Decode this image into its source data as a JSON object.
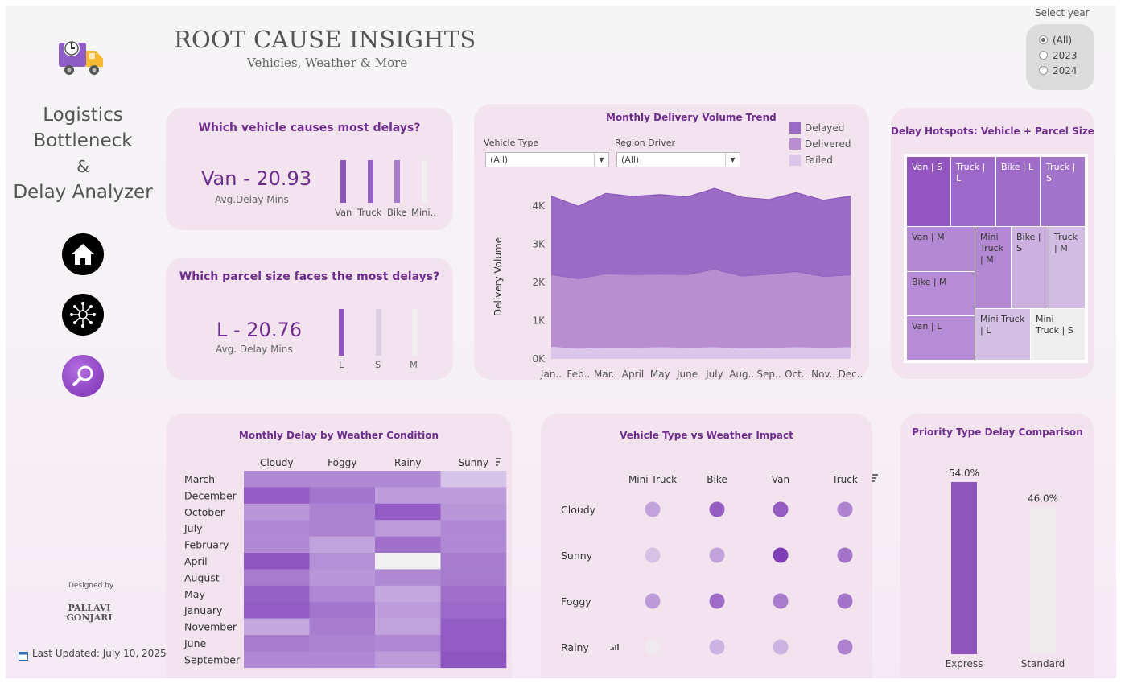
{
  "header": {
    "title": "ROOT CAUSE INSIGHTS",
    "subtitle": "Vehicles, Weather & More"
  },
  "sidebar": {
    "app_title_lines": [
      "Logistics",
      "Bottleneck",
      "&",
      "Delay Analyzer"
    ],
    "nav": [
      {
        "icon": "home-icon"
      },
      {
        "icon": "network-icon"
      },
      {
        "icon": "magnifier-icon"
      }
    ],
    "designed_by_label": "Designed by",
    "designer_name_lines": [
      "PALLAVI",
      "GONJARI"
    ],
    "last_updated": "Last Updated: July 10, 2025"
  },
  "year_filter": {
    "label": "Select year",
    "options": [
      "(All)",
      "2023",
      "2024"
    ],
    "selected": "(All)"
  },
  "vehicle_kpi": {
    "question": "Which vehicle causes most delays?",
    "value": "Van - 20.93",
    "caption": "Avg.Delay Mins",
    "bars": [
      {
        "label": "Van",
        "level": 1.0
      },
      {
        "label": "Truck",
        "level": 1.0
      },
      {
        "label": "Bike",
        "level": 1.0
      },
      {
        "label": "Mini..",
        "level": 1.0
      }
    ]
  },
  "parcel_kpi": {
    "question": "Which parcel size faces the most delays?",
    "value": "L - 20.76",
    "caption": "Avg. Delay Mins",
    "bars": [
      {
        "label": "L"
      },
      {
        "label": "S"
      },
      {
        "label": "M"
      }
    ]
  },
  "colors": {
    "accent": "#8e55bd",
    "title": "#6f2e8e",
    "delayed": "#9b6cc6",
    "delivered": "#b98ed0",
    "failed": "#dcc6ea"
  },
  "trend": {
    "title": "Monthly Delivery Volume Trend",
    "filters": [
      {
        "label": "Vehicle Type",
        "value": "(All)"
      },
      {
        "label": "Region Driver",
        "value": "(All)"
      }
    ],
    "legend": [
      "Delayed",
      "Delivered",
      "Failed"
    ],
    "chart_data": {
      "type": "area",
      "stacked": true,
      "categories": [
        "Jan..",
        "Feb..",
        "Mar..",
        "April",
        "May",
        "June",
        "July",
        "Aug..",
        "Sep..",
        "Oct..",
        "Nov..",
        "Dec.."
      ],
      "ylabel": "Delivery Volume",
      "yticks": [
        "4K",
        "3K",
        "2K",
        "1K",
        "0K"
      ],
      "ylim": [
        0,
        4400
      ],
      "series": [
        {
          "name": "Failed",
          "values": [
            330,
            280,
            300,
            300,
            320,
            300,
            320,
            290,
            300,
            320,
            300,
            320
          ]
        },
        {
          "name": "Delivered",
          "values": [
            1880,
            1820,
            1930,
            1910,
            1900,
            1910,
            2030,
            1880,
            1920,
            1970,
            1860,
            1880
          ]
        },
        {
          "name": "Delayed",
          "values": [
            2050,
            1890,
            2100,
            2040,
            2080,
            2030,
            2110,
            2060,
            1950,
            2060,
            1990,
            2060
          ]
        }
      ]
    }
  },
  "treemap": {
    "title": "Delay Hotspots: Vehicle + Parcel Size",
    "cells": [
      "Van | S",
      "Truck | L",
      "Bike | L",
      "Truck | S",
      "Van | M",
      "Mini Truck | M",
      "Bike | S",
      "Truck | M",
      "Bike | M",
      "Van | L",
      "Mini Truck | L",
      "Mini Truck | S"
    ]
  },
  "weather_heatmap": {
    "title": "Monthly Delay by Weather Condition",
    "columns": [
      "Cloudy",
      "Foggy",
      "Rainy",
      "Sunny"
    ],
    "rows": [
      "March",
      "December",
      "October",
      "July",
      "February",
      "April",
      "August",
      "May",
      "January",
      "November",
      "June",
      "September"
    ],
    "chart_data": {
      "type": "heatmap",
      "x": [
        "Cloudy",
        "Foggy",
        "Rainy",
        "Sunny"
      ],
      "y": [
        "March",
        "December",
        "October",
        "July",
        "February",
        "April",
        "August",
        "May",
        "January",
        "November",
        "June",
        "September"
      ],
      "values": [
        [
          0.55,
          0.55,
          0.55,
          0.1
        ],
        [
          0.9,
          0.7,
          0.4,
          0.4
        ],
        [
          0.45,
          0.6,
          0.9,
          0.45
        ],
        [
          0.55,
          0.6,
          0.4,
          0.55
        ],
        [
          0.55,
          0.35,
          0.75,
          0.55
        ],
        [
          0.95,
          0.5,
          0.0,
          0.65
        ],
        [
          0.65,
          0.45,
          0.55,
          0.65
        ],
        [
          0.85,
          0.55,
          0.3,
          0.75
        ],
        [
          0.9,
          0.7,
          0.4,
          0.8
        ],
        [
          0.3,
          0.65,
          0.35,
          0.9
        ],
        [
          0.65,
          0.6,
          0.55,
          0.9
        ],
        [
          0.55,
          0.55,
          0.4,
          0.95
        ]
      ]
    }
  },
  "vehicle_weather": {
    "title": "Vehicle Type vs Weather Impact",
    "columns": [
      "Mini Truck",
      "Bike",
      "Van",
      "Truck"
    ],
    "rows": [
      "Cloudy",
      "Sunny",
      "Foggy",
      "Rainy"
    ],
    "chart_data": {
      "type": "scatter",
      "x": [
        "Mini Truck",
        "Bike",
        "Van",
        "Truck"
      ],
      "y": [
        "Cloudy",
        "Sunny",
        "Foggy",
        "Rainy"
      ],
      "values": [
        [
          0.35,
          0.8,
          0.8,
          0.55
        ],
        [
          0.15,
          0.35,
          1.0,
          0.65
        ],
        [
          0.4,
          0.7,
          0.6,
          0.65
        ],
        [
          0.0,
          0.25,
          0.25,
          0.55
        ]
      ]
    }
  },
  "priority": {
    "title": "Priority Type Delay Comparison",
    "chart_data": {
      "type": "bar",
      "categories": [
        "Express",
        "Standard"
      ],
      "values": [
        54.0,
        46.0
      ],
      "labels": [
        "54.0%",
        "46.0%"
      ]
    }
  }
}
